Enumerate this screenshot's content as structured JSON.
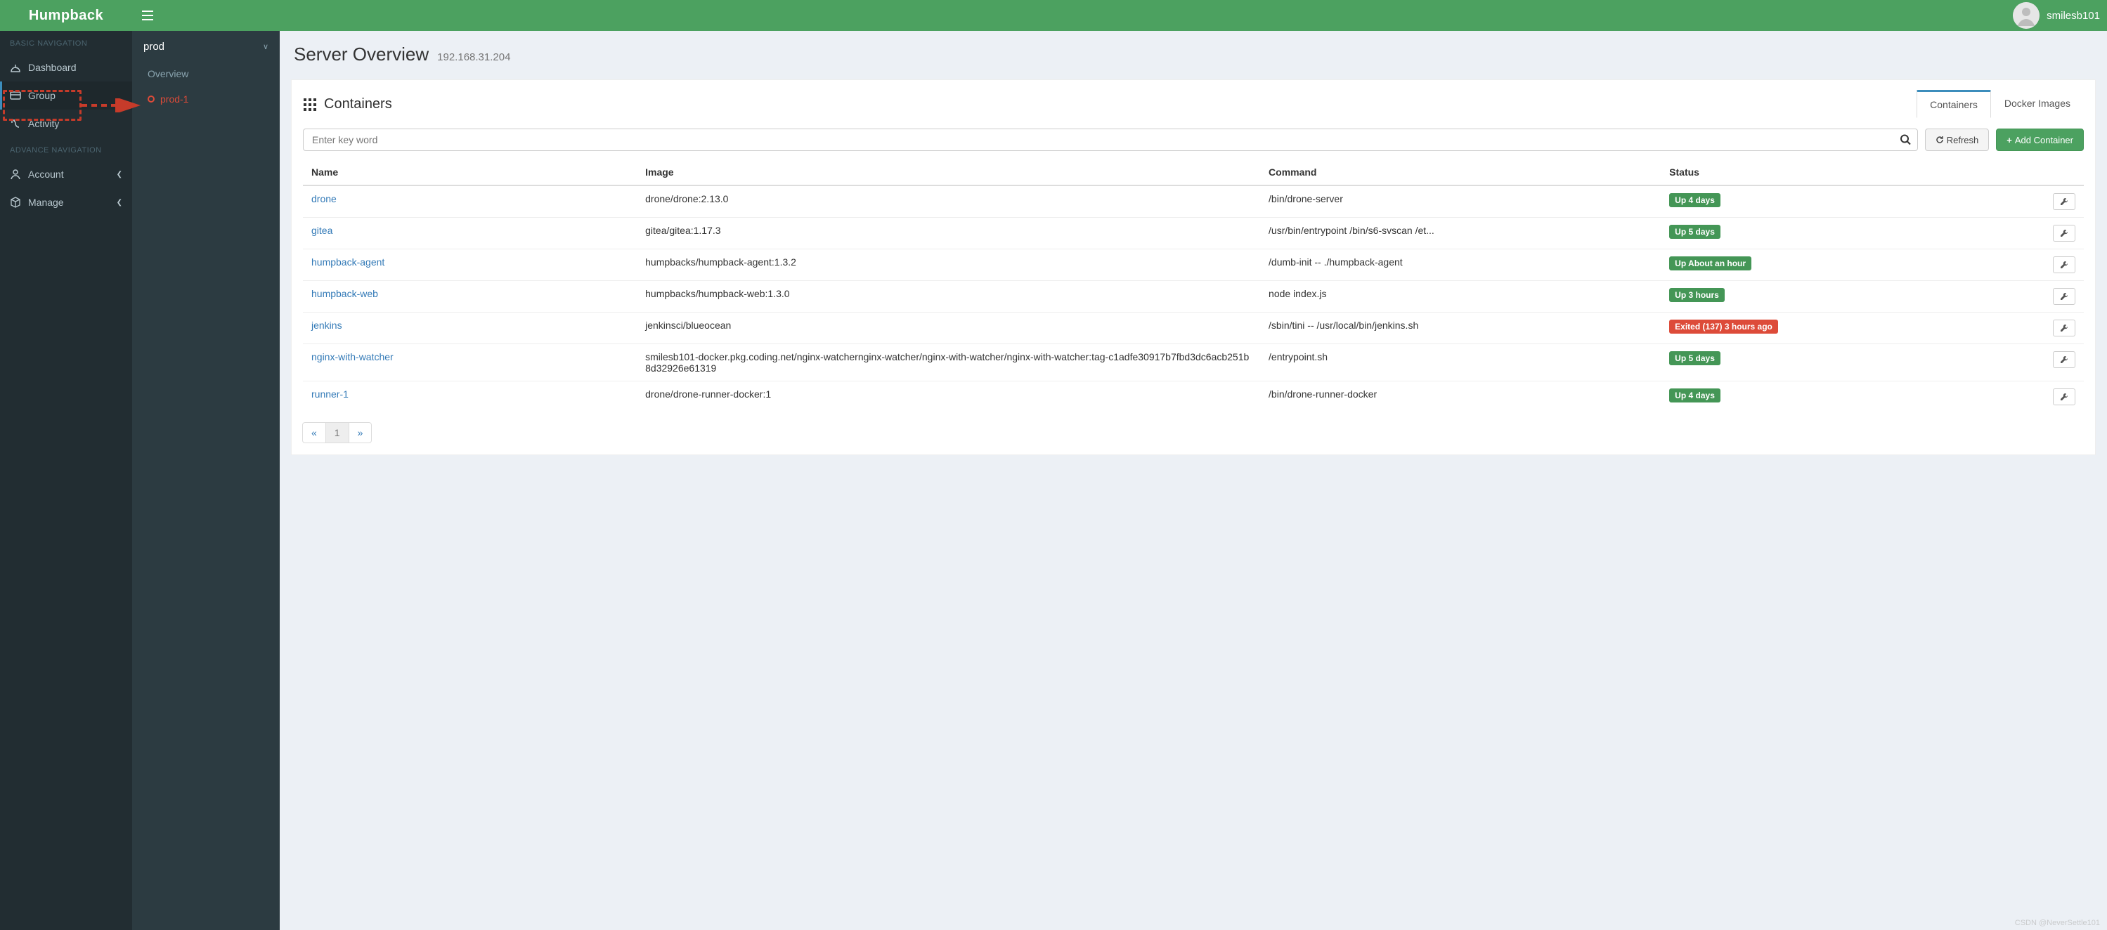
{
  "brand": "Humpback",
  "user": {
    "name": "smilesb101"
  },
  "sidebar": {
    "heading_basic": "BASIC NAVIGATION",
    "heading_advance": "ADVANCE NAVIGATION",
    "items": {
      "dashboard": "Dashboard",
      "group": "Group",
      "activity": "Activity",
      "account": "Account",
      "manage": "Manage"
    }
  },
  "subnav": {
    "group_title": "prod",
    "items": {
      "overview": "Overview",
      "prod1": "prod-1"
    }
  },
  "page": {
    "title": "Server Overview",
    "ip": "192.168.31.204"
  },
  "panel": {
    "title": "Containers",
    "tabs": {
      "containers": "Containers",
      "images": "Docker Images"
    },
    "search_placeholder": "Enter key word",
    "refresh_label": "Refresh",
    "add_label": "Add Container"
  },
  "table": {
    "headers": {
      "name": "Name",
      "image": "Image",
      "command": "Command",
      "status": "Status"
    },
    "rows": [
      {
        "name": "drone",
        "image": "drone/drone:2.13.0",
        "command": "/bin/drone-server",
        "status": "Up 4 days",
        "state": "up"
      },
      {
        "name": "gitea",
        "image": "gitea/gitea:1.17.3",
        "command": "/usr/bin/entrypoint /bin/s6-svscan /et...",
        "status": "Up 5 days",
        "state": "up"
      },
      {
        "name": "humpback-agent",
        "image": "humpbacks/humpback-agent:1.3.2",
        "command": "/dumb-init -- ./humpback-agent",
        "status": "Up About an hour",
        "state": "up"
      },
      {
        "name": "humpback-web",
        "image": "humpbacks/humpback-web:1.3.0",
        "command": "node index.js",
        "status": "Up 3 hours",
        "state": "up"
      },
      {
        "name": "jenkins",
        "image": "jenkinsci/blueocean",
        "command": "/sbin/tini -- /usr/local/bin/jenkins.sh",
        "status": "Exited (137) 3 hours ago",
        "state": "down"
      },
      {
        "name": "nginx-with-watcher",
        "image": "smilesb101-docker.pkg.coding.net/nginx-watchernginx-watcher/nginx-with-watcher/nginx-with-watcher:tag-c1adfe30917b7fbd3dc6acb251b8d32926e61319",
        "command": "/entrypoint.sh",
        "status": "Up 5 days",
        "state": "up"
      },
      {
        "name": "runner-1",
        "image": "drone/drone-runner-docker:1",
        "command": "/bin/drone-runner-docker",
        "status": "Up 4 days",
        "state": "up"
      }
    ]
  },
  "pagination": {
    "prev": "«",
    "page": "1",
    "next": "»"
  },
  "watermark": "CSDN @NeverSettle101"
}
